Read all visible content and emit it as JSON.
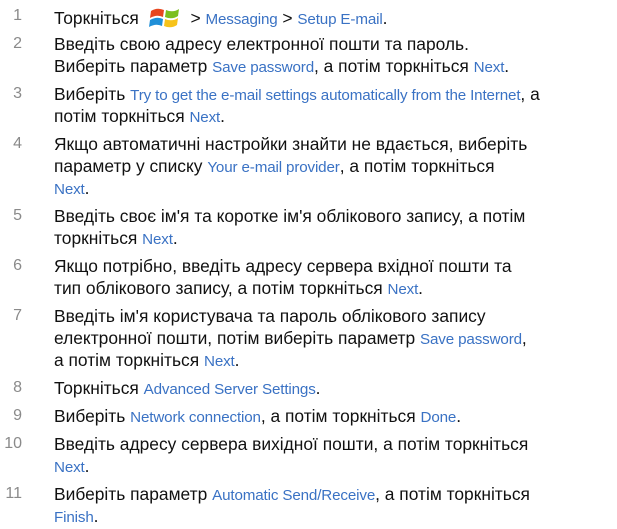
{
  "steps": [
    {
      "number": "1",
      "lines": [
        [
          {
            "t": "Торкніться "
          },
          {
            "icon": "windows-start-icon"
          },
          {
            "t": " > "
          },
          {
            "t": "Messaging",
            "ui": true
          },
          {
            "t": " > "
          },
          {
            "t": "Setup E-mail",
            "ui": true
          },
          {
            "t": "."
          }
        ]
      ]
    },
    {
      "number": "2",
      "lines": [
        [
          {
            "t": "Введіть свою адресу електронної пошти та пароль."
          }
        ],
        [
          {
            "t": "Виберіть параметр "
          },
          {
            "t": "Save password",
            "ui": true
          },
          {
            "t": ", а потім торкніться "
          },
          {
            "t": "Next",
            "ui": true
          },
          {
            "t": "."
          }
        ]
      ]
    },
    {
      "number": "3",
      "lines": [
        [
          {
            "t": "Виберіть "
          },
          {
            "t": "Try to get the e-mail settings automatically from the Internet",
            "ui": true
          },
          {
            "t": ", а"
          }
        ],
        [
          {
            "t": "потім торкніться "
          },
          {
            "t": "Next",
            "ui": true
          },
          {
            "t": "."
          }
        ]
      ]
    },
    {
      "number": "4",
      "lines": [
        [
          {
            "t": "Якщо автоматичні настройки знайти не вдається, виберіть"
          }
        ],
        [
          {
            "t": "параметр у списку "
          },
          {
            "t": "Your e-mail provider",
            "ui": true
          },
          {
            "t": ", а потім торкніться"
          }
        ],
        [
          {
            "t": "Next",
            "ui": true
          },
          {
            "t": "."
          }
        ]
      ]
    },
    {
      "number": "5",
      "lines": [
        [
          {
            "t": "Введіть своє ім'я та коротке ім'я облікового запису, а потім"
          }
        ],
        [
          {
            "t": "торкніться "
          },
          {
            "t": "Next",
            "ui": true
          },
          {
            "t": "."
          }
        ]
      ]
    },
    {
      "number": "6",
      "lines": [
        [
          {
            "t": "Якщо потрібно, введіть адресу сервера вхідної пошти та"
          }
        ],
        [
          {
            "t": "тип облікового запису, а потім торкніться "
          },
          {
            "t": "Next",
            "ui": true
          },
          {
            "t": "."
          }
        ]
      ]
    },
    {
      "number": "7",
      "lines": [
        [
          {
            "t": "Введіть ім'я користувача та пароль облікового запису"
          }
        ],
        [
          {
            "t": "електронної пошти, потім виберіть параметр "
          },
          {
            "t": "Save password",
            "ui": true
          },
          {
            "t": ","
          }
        ],
        [
          {
            "t": "а потім торкніться "
          },
          {
            "t": "Next",
            "ui": true
          },
          {
            "t": "."
          }
        ]
      ]
    },
    {
      "number": "8",
      "lines": [
        [
          {
            "t": "Торкніться "
          },
          {
            "t": "Advanced Server Settings",
            "ui": true
          },
          {
            "t": "."
          }
        ]
      ]
    },
    {
      "number": "9",
      "lines": [
        [
          {
            "t": "Виберіть "
          },
          {
            "t": "Network connection",
            "ui": true
          },
          {
            "t": ", а потім торкніться "
          },
          {
            "t": "Done",
            "ui": true
          },
          {
            "t": "."
          }
        ]
      ]
    },
    {
      "number": "10",
      "lines": [
        [
          {
            "t": "Введіть адресу сервера вихідної пошти, а потім торкніться"
          }
        ],
        [
          {
            "t": "Next",
            "ui": true
          },
          {
            "t": "."
          }
        ]
      ]
    },
    {
      "number": "11",
      "lines": [
        [
          {
            "t": "Виберіть параметр "
          },
          {
            "t": "Automatic Send/Receive",
            "ui": true
          },
          {
            "t": ", а потім торкніться"
          }
        ],
        [
          {
            "t": "Finish",
            "ui": true
          },
          {
            "t": "."
          }
        ]
      ]
    }
  ],
  "colors": {
    "text": "#111111",
    "step_number": "#8a8a8a",
    "ui_term": "#3a72c4"
  }
}
